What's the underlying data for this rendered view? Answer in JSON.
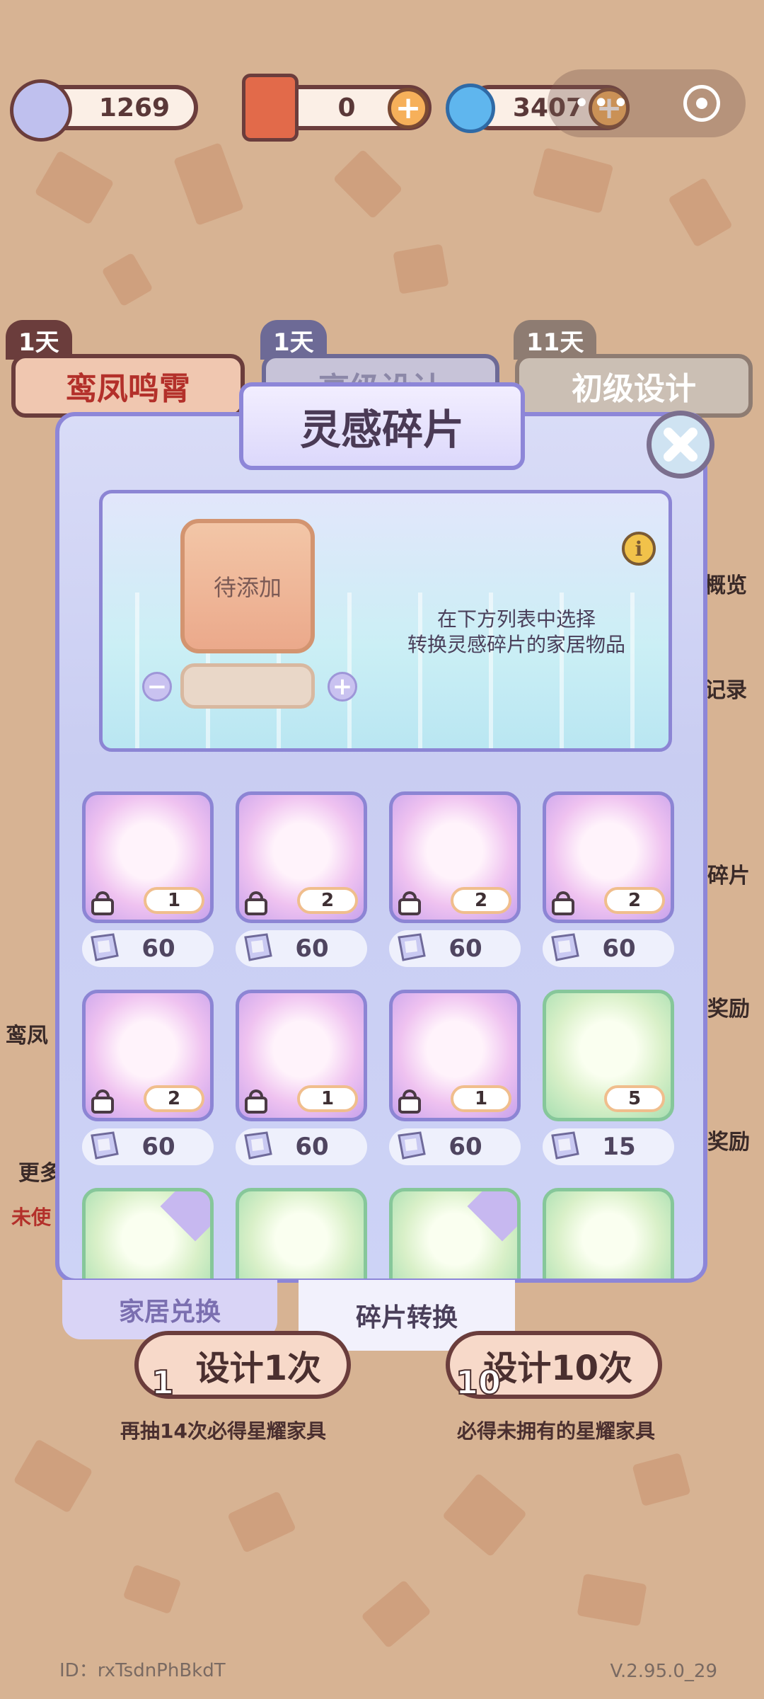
{
  "currencies": {
    "fragments": "1269",
    "scrolls": "0",
    "stars": "3407"
  },
  "tabs_behind": [
    {
      "days": "1天",
      "label": "鸾凤鸣霄"
    },
    {
      "days": "1天",
      "label": "高级设计"
    },
    {
      "days": "11天",
      "label": "初级设计"
    }
  ],
  "side_labels": {
    "overview": "概览",
    "record": "记录",
    "fragment": "碎片",
    "reward1": "奖励",
    "reward2": "奖励",
    "left1": "鸾凤",
    "left2": "更多",
    "left3": "未使"
  },
  "modal": {
    "title": "灵感碎片",
    "pending_label": "待添加",
    "hint_line1": "在下方列表中选择",
    "hint_line2": "转换灵感碎片的家居物品",
    "minus": "−",
    "plus": "+",
    "info": "i"
  },
  "items": [
    {
      "name": "lantern",
      "count": "1",
      "price": "60",
      "locked": true,
      "bg": "purple"
    },
    {
      "name": "fruit-jar",
      "count": "2",
      "price": "60",
      "locked": true,
      "bg": "purple"
    },
    {
      "name": "food-platter",
      "count": "2",
      "price": "60",
      "locked": true,
      "bg": "purple"
    },
    {
      "name": "game-board",
      "count": "2",
      "price": "60",
      "locked": true,
      "bg": "purple"
    },
    {
      "name": "tapestry",
      "count": "2",
      "price": "60",
      "locked": true,
      "bg": "purple"
    },
    {
      "name": "shop-sign",
      "count": "1",
      "price": "60",
      "locked": true,
      "bg": "purple"
    },
    {
      "name": "long-table",
      "count": "1",
      "price": "60",
      "locked": true,
      "bg": "purple"
    },
    {
      "name": "arch-door",
      "count": "5",
      "price": "15",
      "locked": false,
      "bg": "green"
    }
  ],
  "tabs": {
    "furniture_exchange": "家居兑换",
    "fragment_convert": "碎片转换"
  },
  "design": {
    "once_label": "设计1次",
    "once_num": "1",
    "ten_label": "设计10次",
    "ten_num": "10",
    "once_hint": "再抽14次必得星耀家具",
    "ten_hint": "必得未拥有的星耀家具"
  },
  "footer": {
    "id": "ID：rxTsdnPhBkdT",
    "version": "V.2.95.0_29"
  }
}
